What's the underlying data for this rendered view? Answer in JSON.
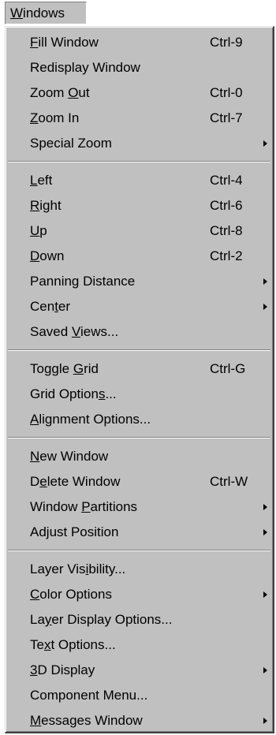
{
  "menu": {
    "title_mnemonic": "W",
    "title_rest": "indows"
  },
  "groups": [
    [
      {
        "pre": "",
        "key": "F",
        "post": "ill Window",
        "shortcut": "Ctrl-9",
        "submenu": false
      },
      {
        "pre": "Redisplay Window",
        "key": "",
        "post": "",
        "shortcut": "",
        "submenu": false
      },
      {
        "pre": "Zoom ",
        "key": "O",
        "post": "ut",
        "shortcut": "Ctrl-0",
        "submenu": false
      },
      {
        "pre": "",
        "key": "Z",
        "post": "oom In",
        "shortcut": "Ctrl-7",
        "submenu": false
      },
      {
        "pre": "Special Zoom",
        "key": "",
        "post": "",
        "shortcut": "",
        "submenu": true
      }
    ],
    [
      {
        "pre": "",
        "key": "L",
        "post": "eft",
        "shortcut": "Ctrl-4",
        "submenu": false
      },
      {
        "pre": "",
        "key": "R",
        "post": "ight",
        "shortcut": "Ctrl-6",
        "submenu": false
      },
      {
        "pre": "",
        "key": "U",
        "post": "p",
        "shortcut": "Ctrl-8",
        "submenu": false
      },
      {
        "pre": "",
        "key": "D",
        "post": "own",
        "shortcut": "Ctrl-2",
        "submenu": false
      },
      {
        "pre": "Panning Distance",
        "key": "",
        "post": "",
        "shortcut": "",
        "submenu": true
      },
      {
        "pre": "Cen",
        "key": "t",
        "post": "er",
        "shortcut": "",
        "submenu": true
      },
      {
        "pre": "Saved ",
        "key": "V",
        "post": "iews...",
        "shortcut": "",
        "submenu": false
      }
    ],
    [
      {
        "pre": "Toggle ",
        "key": "G",
        "post": "rid",
        "shortcut": "Ctrl-G",
        "submenu": false
      },
      {
        "pre": "Grid Option",
        "key": "s",
        "post": "...",
        "shortcut": "",
        "submenu": false
      },
      {
        "pre": "",
        "key": "A",
        "post": "lignment Options...",
        "shortcut": "",
        "submenu": false
      }
    ],
    [
      {
        "pre": "",
        "key": "N",
        "post": "ew Window",
        "shortcut": "",
        "submenu": false
      },
      {
        "pre": "D",
        "key": "e",
        "post": "lete Window",
        "shortcut": "Ctrl-W",
        "submenu": false
      },
      {
        "pre": "Window ",
        "key": "P",
        "post": "artitions",
        "shortcut": "",
        "submenu": true
      },
      {
        "pre": "Adjust Position",
        "key": "",
        "post": "",
        "shortcut": "",
        "submenu": true
      }
    ],
    [
      {
        "pre": "Layer Vis",
        "key": "i",
        "post": "bility...",
        "shortcut": "",
        "submenu": false
      },
      {
        "pre": "",
        "key": "C",
        "post": "olor Options",
        "shortcut": "",
        "submenu": true
      },
      {
        "pre": "La",
        "key": "y",
        "post": "er Display Options...",
        "shortcut": "",
        "submenu": false
      },
      {
        "pre": "Te",
        "key": "x",
        "post": "t Options...",
        "shortcut": "",
        "submenu": false
      },
      {
        "pre": "",
        "key": "3",
        "post": "D Display",
        "shortcut": "",
        "submenu": true
      },
      {
        "pre": "Component Menu...",
        "key": "",
        "post": "",
        "shortcut": "",
        "submenu": false
      },
      {
        "pre": "",
        "key": "M",
        "post": "essages Window",
        "shortcut": "",
        "submenu": true
      }
    ]
  ]
}
